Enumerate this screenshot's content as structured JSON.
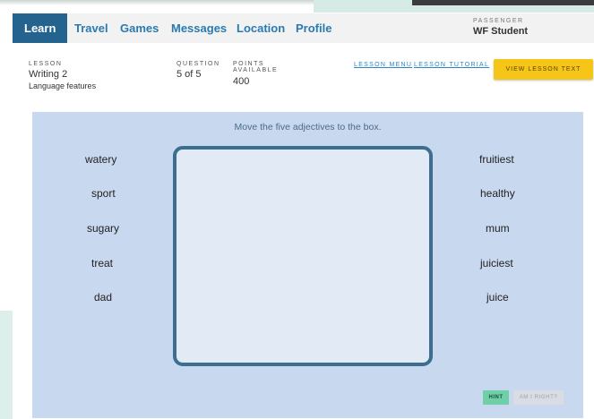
{
  "nav": {
    "items": [
      {
        "label": "Learn"
      },
      {
        "label": "Travel"
      },
      {
        "label": "Games"
      },
      {
        "label": "Messages"
      },
      {
        "label": "Location"
      },
      {
        "label": "Profile"
      }
    ],
    "active": "Learn",
    "passenger_label": "PASSENGER",
    "passenger_name": "WF Student"
  },
  "lesson": {
    "lesson_label": "LESSON",
    "lesson_name": "Writing 2",
    "lesson_topic": "Language features",
    "question_label": "QUESTION",
    "question_value": "5 of 5",
    "points_label_1": "POINTS",
    "points_label_2": "AVAILABLE",
    "points_value": "400",
    "menu_link": "LESSON MENU",
    "tutorial_link": "LESSON TUTORIAL",
    "view_text_button": "VIEW LESSON TEXT"
  },
  "activity": {
    "instruction": "Move the five adjectives to the box.",
    "left_words": [
      "watery",
      "sport",
      "sugary",
      "treat",
      "dad"
    ],
    "right_words": [
      "fruitiest",
      "healthy",
      "mum",
      "juiciest",
      "juice"
    ],
    "hint_button": "HINT",
    "check_button": "AM I RIGHT?"
  },
  "colors": {
    "nav_active": "#25638f",
    "nav_link": "#2a7ab0",
    "panel": "#c8d8ee",
    "dropbox_border": "#3c6e90",
    "view_button": "#f5c518",
    "hint_button": "#6fcfa7"
  }
}
